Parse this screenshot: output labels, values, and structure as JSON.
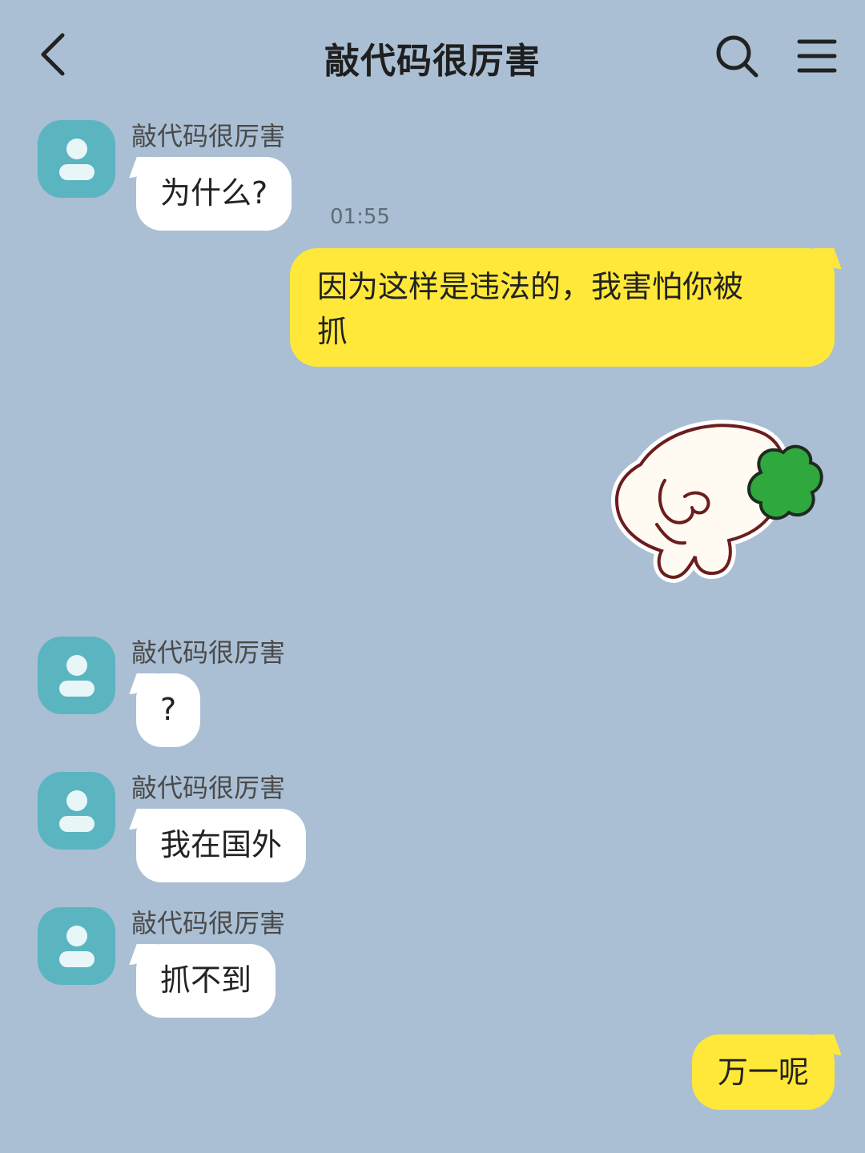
{
  "header": {
    "title": "敲代码很厉害",
    "back_icon": "chevron-left-icon",
    "search_icon": "search-icon",
    "menu_icon": "menu-icon"
  },
  "messages": [
    {
      "direction": "in",
      "sender": "敲代码很厉害",
      "text": "为什么?",
      "time": "01:55"
    },
    {
      "direction": "out",
      "line1": "因为这样是违法的，我害怕你被",
      "line2": "抓"
    },
    {
      "direction": "out",
      "type": "sticker",
      "sticker_icon": "bunny-sticker-icon"
    },
    {
      "direction": "in",
      "sender": "敲代码很厉害",
      "text": "?"
    },
    {
      "direction": "in",
      "sender": "敲代码很厉害",
      "text": "我在国外"
    },
    {
      "direction": "in",
      "sender": "敲代码很厉害",
      "text": "抓不到"
    },
    {
      "direction": "out",
      "text": "万一呢"
    }
  ],
  "colors": {
    "background": "#aabfd3",
    "outgoing_bubble": "#ffe83a",
    "incoming_bubble": "#ffffff",
    "avatar": "#5ab5c1",
    "sticker_leaf": "#2fa93e"
  }
}
